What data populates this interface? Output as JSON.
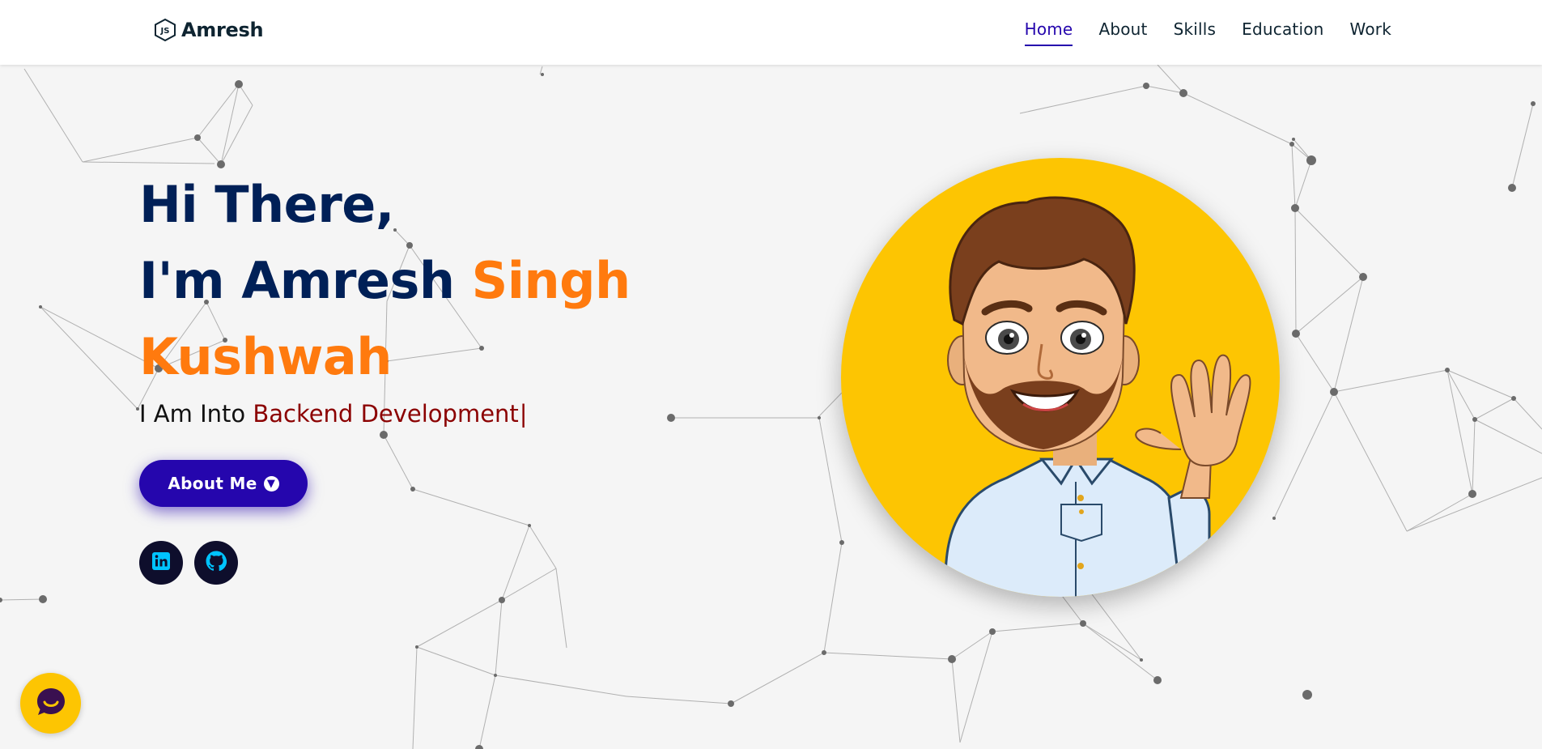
{
  "brand": {
    "name": "Amresh",
    "logo_icon": "nodejs-hexagon-icon"
  },
  "nav": {
    "items": [
      {
        "label": "Home",
        "active": true
      },
      {
        "label": "About",
        "active": false
      },
      {
        "label": "Skills",
        "active": false
      },
      {
        "label": "Education",
        "active": false
      },
      {
        "label": "Work",
        "active": false
      }
    ]
  },
  "hero": {
    "line1": "Hi There,",
    "line2_prefix": "I'm Amresh",
    "name_highlight_1": "Singh",
    "name_highlight_2": "Kushwah",
    "typing_prefix": "I Am Into",
    "typing_value": "Backend Development",
    "typing_cursor": "|"
  },
  "cta": {
    "label": "About Me",
    "icon": "arrow-down-circle-icon"
  },
  "socials": [
    {
      "name": "LinkedIn",
      "icon": "linkedin-icon"
    },
    {
      "name": "GitHub",
      "icon": "github-icon"
    }
  ],
  "avatar": {
    "icon": "bitmoji-waving-avatar"
  },
  "chat": {
    "icon": "chat-bubble-icon"
  },
  "colors": {
    "navy": "#002057",
    "orange": "#ff7a0e",
    "purple": "#2506ad",
    "darkred": "#8b0000",
    "yellow": "#fdc502"
  }
}
